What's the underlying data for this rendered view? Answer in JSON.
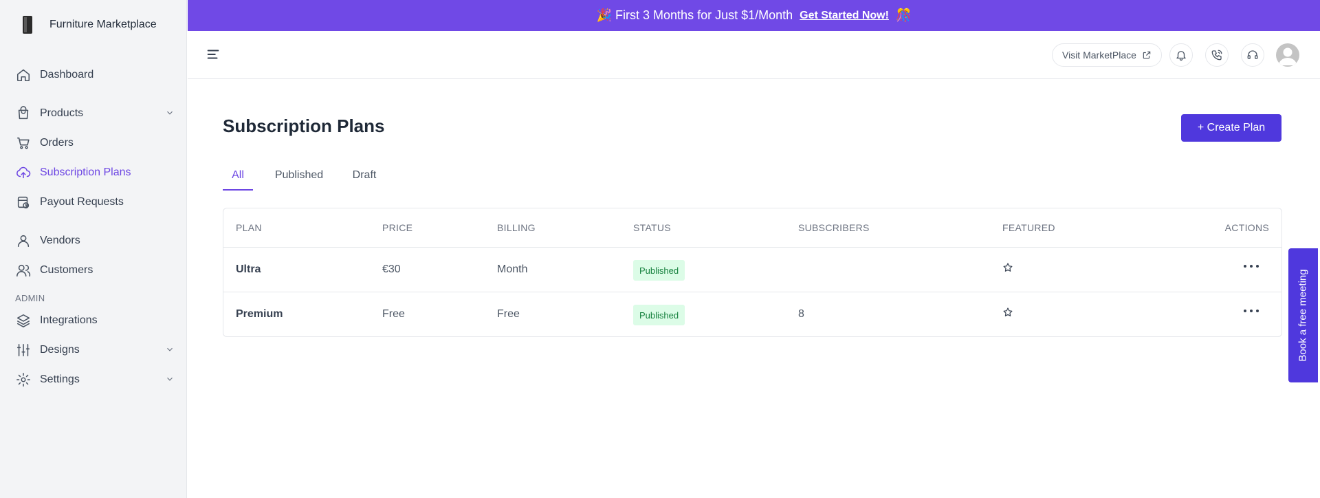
{
  "brand": {
    "name": "Furniture Marketplace"
  },
  "banner": {
    "text": "🎉 First 3 Months for Just $1/Month",
    "link": "Get Started Now!",
    "emoji_end": "🎊"
  },
  "header": {
    "visit_label": "Visit MarketPlace"
  },
  "sidebar": {
    "items": [
      {
        "label": "Dashboard"
      },
      {
        "label": "Products"
      },
      {
        "label": "Orders"
      },
      {
        "label": "Subscription Plans"
      },
      {
        "label": "Payout Requests"
      },
      {
        "label": "Vendors"
      },
      {
        "label": "Customers"
      },
      {
        "label": "Integrations"
      },
      {
        "label": "Designs"
      },
      {
        "label": "Settings"
      }
    ],
    "section_admin": "ADMIN"
  },
  "page": {
    "title": "Subscription Plans",
    "create_label": "+ Create Plan"
  },
  "tabs": [
    {
      "label": "All"
    },
    {
      "label": "Published"
    },
    {
      "label": "Draft"
    }
  ],
  "table": {
    "headers": [
      "PLAN",
      "PRICE",
      "BILLING",
      "STATUS",
      "SUBSCRIBERS",
      "FEATURED",
      "ACTIONS"
    ],
    "rows": [
      {
        "plan": "Ultra",
        "price": "€30",
        "billing": "Month",
        "status": "Published",
        "subscribers": ""
      },
      {
        "plan": "Premium",
        "price": "Free",
        "billing": "Free",
        "status": "Published",
        "subscribers": "8"
      }
    ]
  },
  "meeting": {
    "label": "Book a free meeting"
  },
  "colors": {
    "accent": "#6d46e3",
    "banner": "#7049e6",
    "button": "#4f38dd",
    "badge_bg": "#dcfce7",
    "badge_text": "#15803d"
  }
}
